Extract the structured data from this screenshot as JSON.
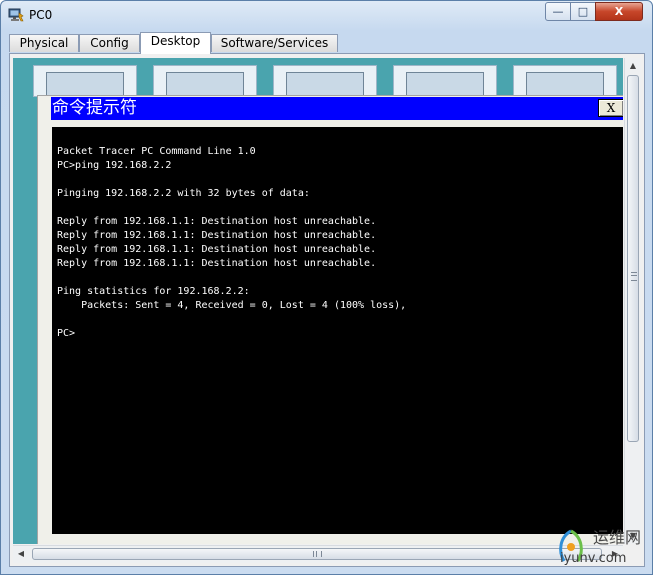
{
  "window": {
    "title": "PC0",
    "controls": {
      "minimize": "—",
      "maximize": "□",
      "close": "X"
    }
  },
  "tabs": [
    {
      "label": "Physical",
      "active": false
    },
    {
      "label": "Config",
      "active": false
    },
    {
      "label": "Desktop",
      "active": true
    },
    {
      "label": "Software/Services",
      "active": false
    }
  ],
  "command_prompt": {
    "title": "命令提示符",
    "close_label": "X",
    "lines": [
      "Packet Tracer PC Command Line 1.0",
      "PC>ping 192.168.2.2",
      "",
      "Pinging 192.168.2.2 with 32 bytes of data:",
      "",
      "Reply from 192.168.1.1: Destination host unreachable.",
      "Reply from 192.168.1.1: Destination host unreachable.",
      "Reply from 192.168.1.1: Destination host unreachable.",
      "Reply from 192.168.1.1: Destination host unreachable.",
      "",
      "Ping statistics for 192.168.2.2:",
      "    Packets: Sent = 4, Received = 0, Lost = 4 (100% loss),",
      "",
      "PC>"
    ]
  },
  "watermark": {
    "cn": "运维网",
    "en": "iyunv.com"
  },
  "icons": {
    "app": "packet-tracer-pc-icon",
    "scroll_up": "▲",
    "scroll_down": "▼",
    "scroll_left": "◀",
    "scroll_right": "▶"
  },
  "colors": {
    "cmd_title_bg": "#0000ff",
    "console_bg": "#000000",
    "console_text": "#ffffff",
    "desktop_bg": "#4aa4ae",
    "close_button": "#c7462a"
  }
}
